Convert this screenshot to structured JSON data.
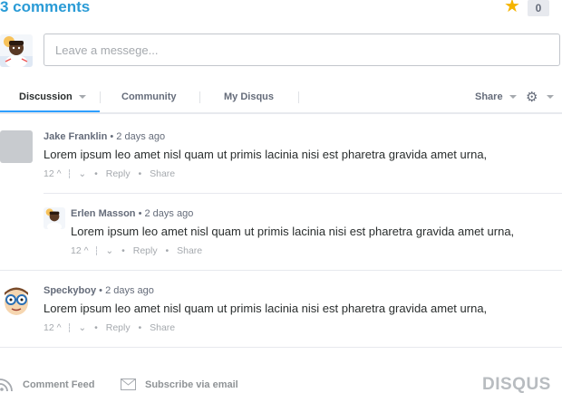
{
  "header": {
    "comment_count": "3 comments",
    "star_count": "0"
  },
  "composer": {
    "placeholder": "Leave a messege..."
  },
  "nav": {
    "tabs": [
      "Discussion",
      "Community",
      "My Disqus"
    ],
    "share_label": "Share"
  },
  "comments": [
    {
      "author": "Jake Franklin",
      "time": "• 2 days ago",
      "body": "Lorem ipsum leo amet nisl quam ut primis lacinia nisi est pharetra gravida amet urna,",
      "votes": "12",
      "reply": "Reply",
      "share": "Share"
    },
    {
      "author": "Erlen Masson",
      "time": "• 2 days ago",
      "body": "Lorem ipsum leo amet nisl quam ut primis lacinia nisi est pharetra gravida amet urna,",
      "votes": "12",
      "reply": "Reply",
      "share": "Share"
    },
    {
      "author": "Speckyboy",
      "time": "• 2 days ago",
      "body": "Lorem ipsum leo amet nisl quam ut primis lacinia nisi est pharetra gravida amet urna,",
      "votes": "12",
      "reply": "Reply",
      "share": "Share"
    }
  ],
  "bottom": {
    "comment_feed": "Comment Feed",
    "subscribe": "Subscribe via email",
    "logo": "DISQUS"
  },
  "colors": {
    "accent": "#2a9bd6",
    "star": "#f5b400",
    "tab_underline": "#2e9fff"
  }
}
